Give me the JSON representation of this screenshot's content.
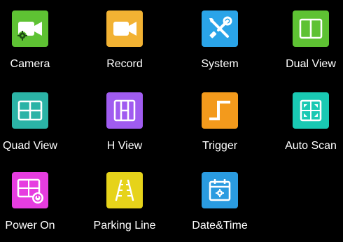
{
  "menu": {
    "items": [
      {
        "label": "Camera",
        "icon": "camera-icon",
        "color": "#5ec233"
      },
      {
        "label": "Record",
        "icon": "record-icon",
        "color": "#f2b233"
      },
      {
        "label": "System",
        "icon": "system-tools-icon",
        "color": "#2aa4e8"
      },
      {
        "label": "Dual View",
        "icon": "dual-view-icon",
        "color": "#5ec233"
      },
      {
        "label": "Quad View",
        "icon": "quad-view-icon",
        "color": "#2bb3a6"
      },
      {
        "label": "H View",
        "icon": "h-view-icon",
        "color": "#a05cf0"
      },
      {
        "label": "Trigger",
        "icon": "trigger-icon",
        "color": "#f39a1c"
      },
      {
        "label": "Auto Scan",
        "icon": "auto-scan-icon",
        "color": "#19c9b3"
      },
      {
        "label": "Power On",
        "icon": "power-on-icon",
        "color": "#e63de0"
      },
      {
        "label": "Parking Line",
        "icon": "parking-line-icon",
        "color": "#e6d31a"
      },
      {
        "label": "Date&Time",
        "icon": "calendar-icon",
        "color": "#2a9be0"
      }
    ]
  }
}
